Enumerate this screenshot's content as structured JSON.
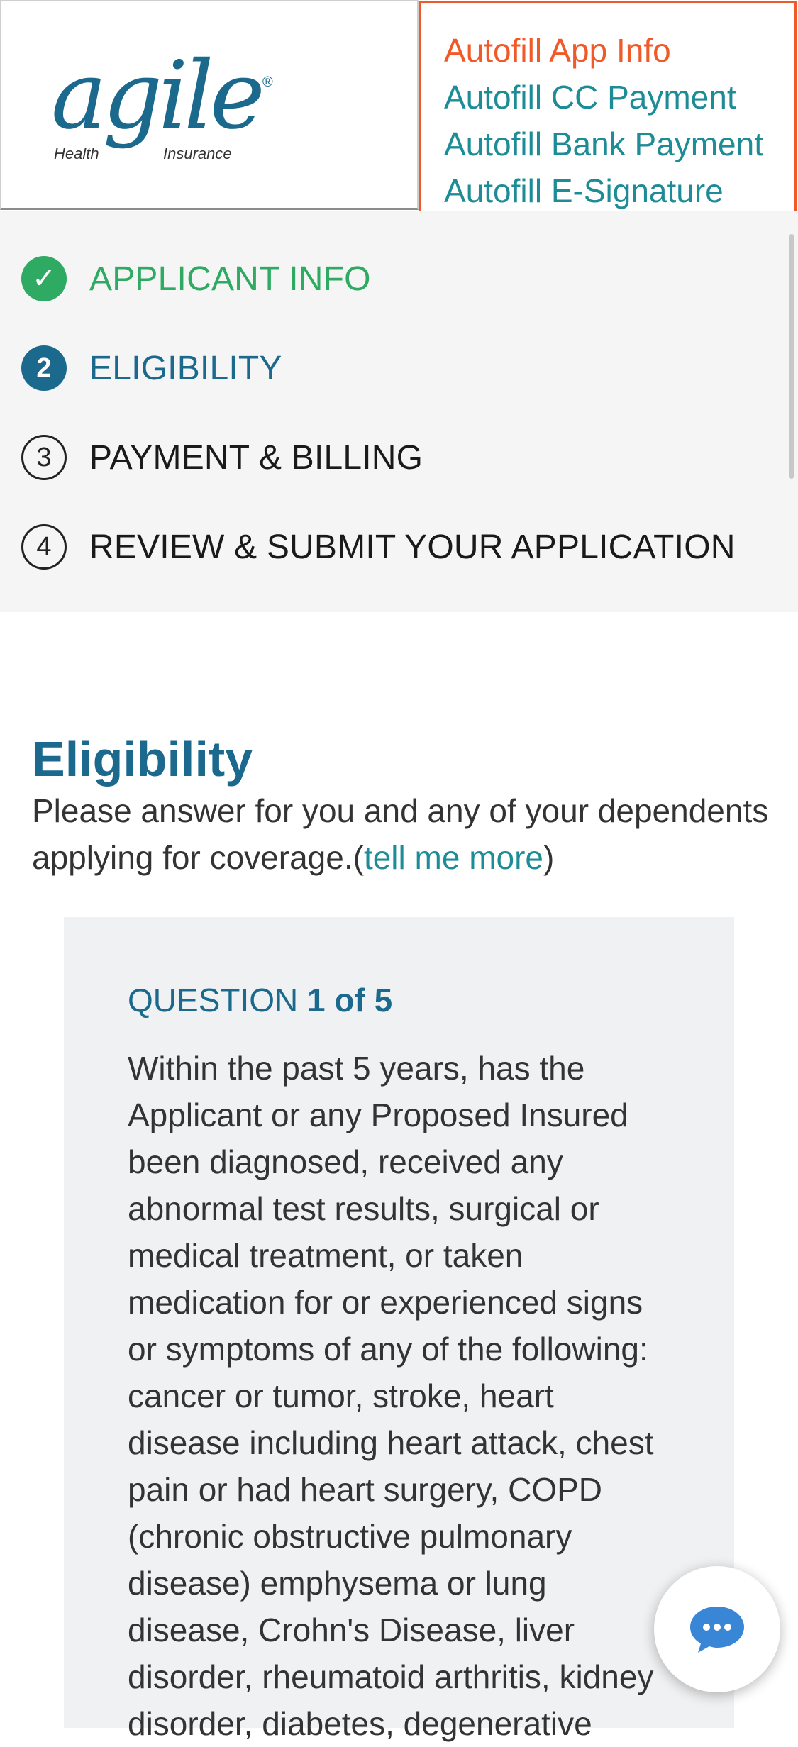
{
  "brand": {
    "logo_word": "agile",
    "logo_sub_left": "Health",
    "logo_sub_right": "Insurance",
    "logo_mark": "®",
    "colors": {
      "primary": "#1b6a8e",
      "accent": "#1e8c96",
      "success": "#2eaa62",
      "highlight": "#f05a28"
    }
  },
  "autofill": {
    "links": [
      {
        "label": "Autofill App Info"
      },
      {
        "label": "Autofill CC Payment"
      },
      {
        "label": "Autofill Bank Payment"
      },
      {
        "label": "Autofill E-Signature"
      }
    ]
  },
  "steps": [
    {
      "badge": "✓",
      "label": "APPLICANT INFO",
      "state": "done"
    },
    {
      "badge": "2",
      "label": "ELIGIBILITY",
      "state": "current"
    },
    {
      "badge": "3",
      "label": "PAYMENT & BILLING",
      "state": "todo"
    },
    {
      "badge": "4",
      "label": "REVIEW & SUBMIT YOUR APPLICATION",
      "state": "todo"
    }
  ],
  "eligibility": {
    "title": "Eligibility",
    "intro_text": "Please answer for you and any of your dependents applying for coverage.(",
    "intro_link": "tell me more",
    "intro_close": ")",
    "question_prefix": "QUESTION",
    "question_count": "1 of 5",
    "question_text": "Within the past 5 years, has the Applicant or any Proposed Insured been diagnosed, received any abnormal test results, surgical or medical treatment, or taken medication for or experienced signs or symptoms of any of the following: cancer or tumor, stroke, heart disease including heart attack, chest pain or had heart surgery, COPD (chronic obstructive pulmonary disease) emphysema or lung disease, Crohn's Disease, liver disorder, rheumatoid arthritis, kidney disorder, diabetes, degenerative"
  },
  "chat": {
    "icon": "chat-bubble-icon"
  }
}
